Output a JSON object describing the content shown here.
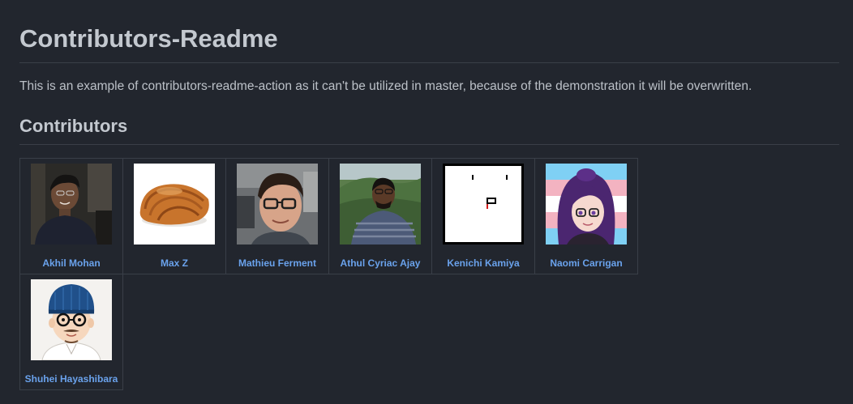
{
  "page": {
    "title": "Contributors-Readme",
    "description": "This is an example of contributors-readme-action as it can't be utilized in master, because of the demonstration it will be overwritten.",
    "section_heading": "Contributors"
  },
  "contributors": [
    {
      "name": "Akhil Mohan",
      "avatar": "avatar-photo-man-dark-background"
    },
    {
      "name": "Max Z",
      "avatar": "avatar-pain-au-chocolat-pastry"
    },
    {
      "name": "Mathieu Ferment",
      "avatar": "avatar-photo-man-glasses"
    },
    {
      "name": "Athul Cyriac Ajay",
      "avatar": "avatar-photo-man-green-hills"
    },
    {
      "name": "Kenichi Kamiya",
      "avatar": "avatar-pixel-face"
    },
    {
      "name": "Naomi Carrigan",
      "avatar": "avatar-anime-girl-flag-background"
    },
    {
      "name": "Shuhei Hayashibara",
      "avatar": "avatar-cartoon-man-beanie"
    }
  ],
  "colors": {
    "background": "#22262e",
    "link": "#6aa2ec",
    "heading": "#c3c8cf",
    "border": "#3a3f48"
  }
}
